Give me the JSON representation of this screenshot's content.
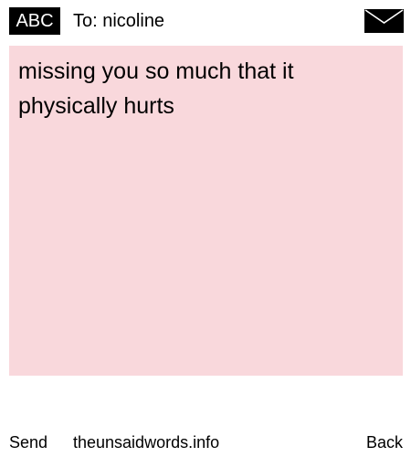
{
  "header": {
    "badge": "ABC",
    "to_label": "To: nicoline",
    "icon": "envelope-icon"
  },
  "message": {
    "text": "missing you so much that it physically hurts",
    "background": "#f9d8dc"
  },
  "footer": {
    "send_label": "Send",
    "site_label": "theunsaidwords.info",
    "back_label": "Back"
  }
}
